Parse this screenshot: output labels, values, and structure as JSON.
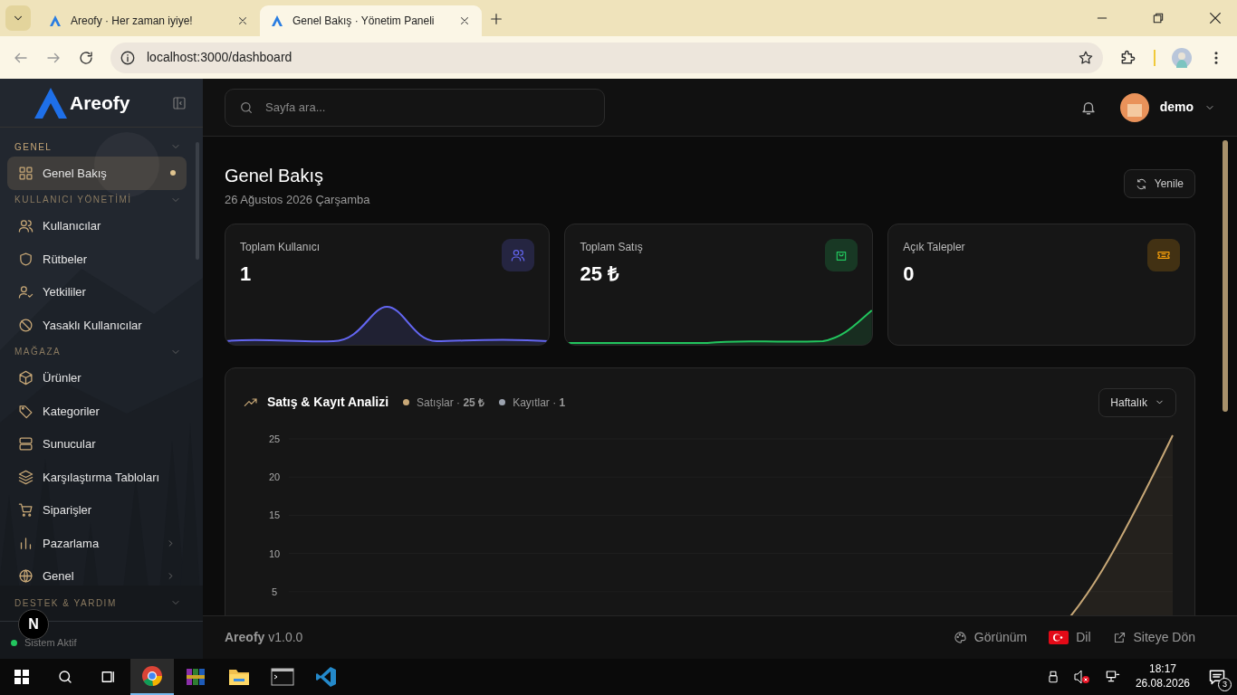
{
  "browser": {
    "tabs": [
      {
        "title": "Areofy · Her zaman iyiye!",
        "selected": false
      },
      {
        "title": "Genel Bakış · Yönetim Paneli",
        "selected": true
      }
    ],
    "address": "localhost:3000/dashboard"
  },
  "sidebar": {
    "logo": "Areofy",
    "sections": [
      {
        "title": "GENEL",
        "expanded": true,
        "items": [
          {
            "label": "Genel Bakış",
            "selected": true,
            "submenu": false
          }
        ]
      },
      {
        "title": "KULLANICI YÖNETİMİ",
        "expanded": true,
        "items": [
          {
            "label": "Kullanıcılar",
            "selected": false,
            "submenu": false
          },
          {
            "label": "Rütbeler",
            "selected": false,
            "submenu": false
          },
          {
            "label": "Yetkililer",
            "selected": false,
            "submenu": false
          },
          {
            "label": "Yasaklı Kullanıcılar",
            "selected": false,
            "submenu": false
          }
        ]
      },
      {
        "title": "MAĞAZA",
        "expanded": true,
        "items": [
          {
            "label": "Ürünler",
            "selected": false,
            "submenu": false
          },
          {
            "label": "Kategoriler",
            "selected": false,
            "submenu": false
          },
          {
            "label": "Sunucular",
            "selected": false,
            "submenu": false
          },
          {
            "label": "Karşılaştırma Tabloları",
            "selected": false,
            "submenu": false
          },
          {
            "label": "Siparişler",
            "selected": false,
            "submenu": false
          },
          {
            "label": "Pazarlama",
            "selected": false,
            "submenu": true
          },
          {
            "label": "Genel",
            "selected": false,
            "submenu": true
          }
        ]
      },
      {
        "title": "DESTEK & YARDIM",
        "expanded": true
      }
    ],
    "dev_badge": "N",
    "status": "Sistem Aktif"
  },
  "header": {
    "search": {
      "placeholder": "Sayfa ara..."
    },
    "user": "demo"
  },
  "page": {
    "title": "Genel Bakış",
    "date": "26 Ağustos 2026 Çarşamba",
    "refresh": "Yenile"
  },
  "stats": [
    {
      "label": "Toplam Kullanıcı",
      "value": "1",
      "color": "#6366f1",
      "kind": "bump"
    },
    {
      "label": "Toplam Satış",
      "value": "25 ₺",
      "color": "#22c55e",
      "kind": "rise"
    },
    {
      "label": "Açık Talepler",
      "value": "0",
      "color": "#f59e0b",
      "kind": "none"
    }
  ],
  "analysis": {
    "title": "Satış & Kayıt Analizi",
    "legend": [
      {
        "text": "Satışlar · **25 ₺**",
        "color": "#c8a877"
      },
      {
        "text": "Kayıtlar · **1**",
        "color": "#9ca3af"
      }
    ],
    "period": "Haftalık",
    "axis_labels": [
      "25",
      "20",
      "15",
      "10",
      "5"
    ]
  },
  "footer": {
    "brand": "**Areofy** v1.0.0",
    "links": [
      "Görünüm",
      "Dil",
      "Siteye Dön"
    ]
  },
  "taskbar": {
    "time": "18:17",
    "date": "26.08.2026",
    "notifications": "3"
  }
}
